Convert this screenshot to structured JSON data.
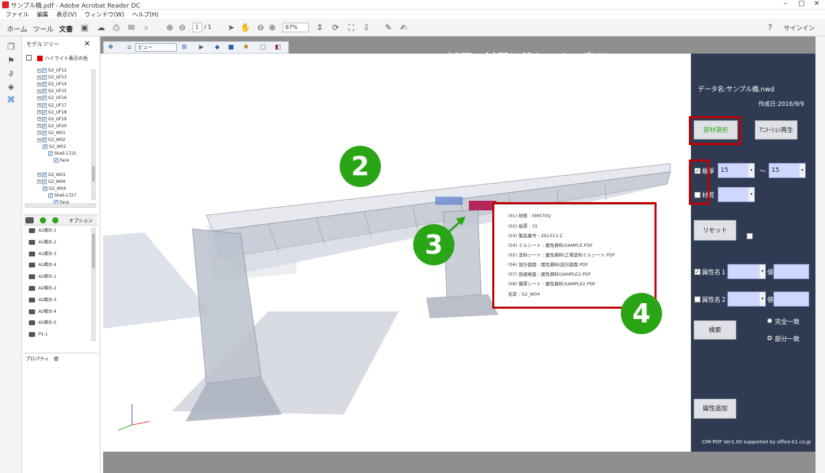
{
  "window": {
    "title": "サンプル橋.pdf - Adobe Acrobat Reader DC"
  },
  "menu": [
    "ファイル",
    "編集",
    "表示(V)",
    "ウィンドウ(W)",
    "ヘルプ(H)"
  ],
  "toolbar": {
    "tabs": [
      "ホーム",
      "ツール",
      "文書"
    ],
    "page_current": "1",
    "page_total": "/ 1",
    "zoom": "67%",
    "signin": "サインイン"
  },
  "tree_panel": {
    "title": "モデルツリー",
    "highlight_label": "ハイライト表示の色",
    "nodes": [
      {
        "label": "G2_UF12",
        "indent": 0
      },
      {
        "label": "G2_UF13",
        "indent": 0
      },
      {
        "label": "G2_UF14",
        "indent": 0
      },
      {
        "label": "G2_UF15",
        "indent": 0
      },
      {
        "label": "G2_UF16",
        "indent": 0
      },
      {
        "label": "G2_UF17",
        "indent": 0
      },
      {
        "label": "G2_UF18",
        "indent": 0
      },
      {
        "label": "G2_UF19",
        "indent": 0
      },
      {
        "label": "G2_UF20",
        "indent": 0
      },
      {
        "label": "G2_W01",
        "indent": 0
      },
      {
        "label": "G2_W02",
        "indent": 0
      },
      {
        "label": "G2_W02",
        "indent": 1
      },
      {
        "label": "Shell-1725",
        "indent": 2
      },
      {
        "label": "Face",
        "indent": 3
      },
      {
        "label": "",
        "indent": 0
      },
      {
        "label": "G2_W03",
        "indent": 0
      },
      {
        "label": "G2_W04",
        "indent": 0
      },
      {
        "label": "G2_W04",
        "indent": 1
      },
      {
        "label": "Shell-1727",
        "indent": 2
      },
      {
        "label": "Face",
        "indent": 3
      }
    ],
    "options_label": "オプション",
    "list_items": [
      "A1橋台-1",
      "A1橋台-2",
      "A1橋台-3",
      "A1橋台-4",
      "A2橋台-1",
      "A2橋台-2",
      "A2橋台-3",
      "A2橋台-4",
      "A2橋台-5",
      "P1-1"
    ],
    "prop_tab": "プロパティ",
    "value_tab": "値"
  },
  "view_toolbar": {
    "view_label": "ビュー"
  },
  "canvas": {
    "heading": "板厚・材質は等しいもの表示"
  },
  "tooltip": {
    "lines": [
      "(01) 材質 : SM570Q",
      "(02) 板厚 : 15",
      "(03) 製品番号 : 291313-2",
      "(04) ミルシート : 属性資料\\SAMPLE.PDF",
      "(05) 塗料シート : 属性資料\\工場塗料ミルシート.PDF",
      "(06) 設計図面 : 属性資料\\設計図面.PDF",
      "(07) 仮組検査 : 属性資料\\SAMPLE2.PDF",
      "(08) 膜厚シート : 属性資料\\SAMPLE2.PDF",
      "名前 : G2_W04"
    ]
  },
  "badges": [
    "2",
    "3",
    "4"
  ],
  "right_panel": {
    "data_name": "データ名:サンプル橋.nwd",
    "created": "作成日:2016/9/9",
    "member_select": "部材選択",
    "animation": "ｱﾆﾒｰｼｮﾝ再生",
    "thickness_label": "板厚",
    "thickness_from": "15",
    "tilde": "～",
    "thickness_to": "15",
    "material_label": "材質",
    "material_value": "",
    "reset": "リセット",
    "attr1": "属性名１",
    "attr2": "属性名２",
    "value_label": "値",
    "search": "検索",
    "exact": "完全一致",
    "partial": "部分一致",
    "add_attr": "属性追加",
    "footer": "CIM-PDF Ver1.00 supported by office-k1.co.jp"
  },
  "colors": {
    "panel_bg": "#2f3b53",
    "badge_green": "#2aa515",
    "highlight_red": "#c00000",
    "field_blue": "#cfd7ff"
  },
  "icons": [
    "pages-icon",
    "bookmark-icon",
    "paperclip-icon",
    "layers-icon",
    "model-tree-icon",
    "save-icon",
    "upload-icon",
    "print-icon",
    "mail-icon",
    "search-icon",
    "prev-page-icon",
    "next-page-icon",
    "select-arrow-icon",
    "hand-icon",
    "zoom-out-icon",
    "zoom-in-icon",
    "fit-icon",
    "help-icon"
  ]
}
